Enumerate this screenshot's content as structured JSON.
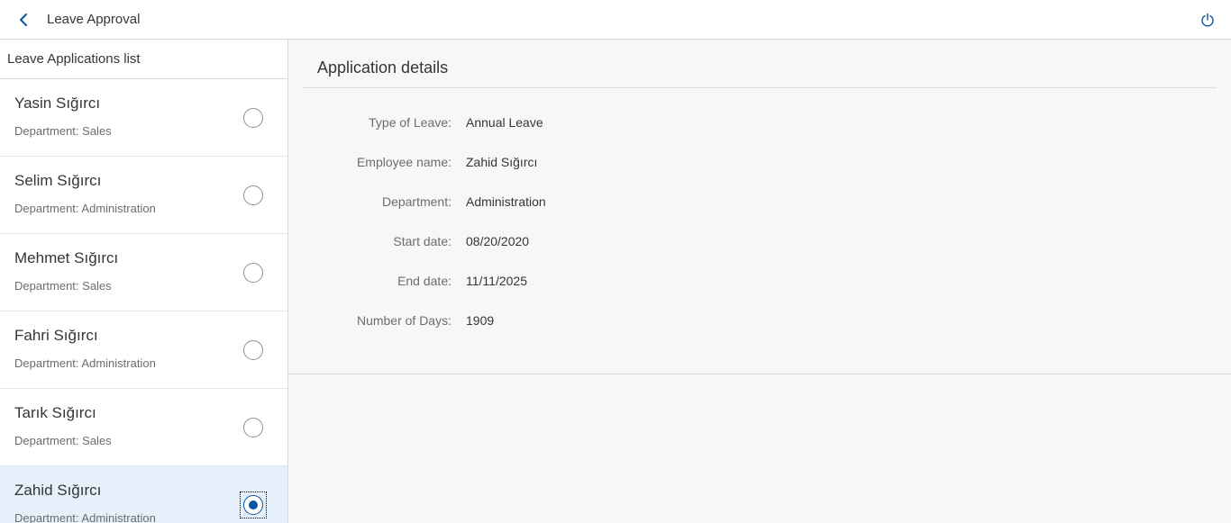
{
  "header": {
    "title": "Leave Approval",
    "back_icon": "chevron-left-icon",
    "power_icon": "power-icon"
  },
  "master": {
    "title": "Leave Applications list",
    "items": [
      {
        "name": "Yasin Sığırcı",
        "department": "Department: Sales",
        "selected": false
      },
      {
        "name": "Selim Sığırcı",
        "department": "Department: Administration",
        "selected": false
      },
      {
        "name": "Mehmet Sığırcı",
        "department": "Department: Sales",
        "selected": false
      },
      {
        "name": "Fahri Sığırcı",
        "department": "Department: Administration",
        "selected": false
      },
      {
        "name": "Tarık Sığırcı",
        "department": "Department: Sales",
        "selected": false
      },
      {
        "name": "Zahid Sığırcı",
        "department": "Department: Administration",
        "selected": true
      }
    ]
  },
  "detail": {
    "title": "Application details",
    "fields": [
      {
        "label": "Type of Leave:",
        "value": "Annual Leave"
      },
      {
        "label": "Employee name:",
        "value": "Zahid Sığırcı"
      },
      {
        "label": "Department:",
        "value": "Administration"
      },
      {
        "label": "Start date:",
        "value": "08/20/2020"
      },
      {
        "label": "End date:",
        "value": "11/11/2025"
      },
      {
        "label": "Number of Days:",
        "value": "1909"
      }
    ]
  },
  "colors": {
    "accent": "#0854a0",
    "selected_bg": "#e5f0fa",
    "detail_bg": "#f7f7f7"
  }
}
